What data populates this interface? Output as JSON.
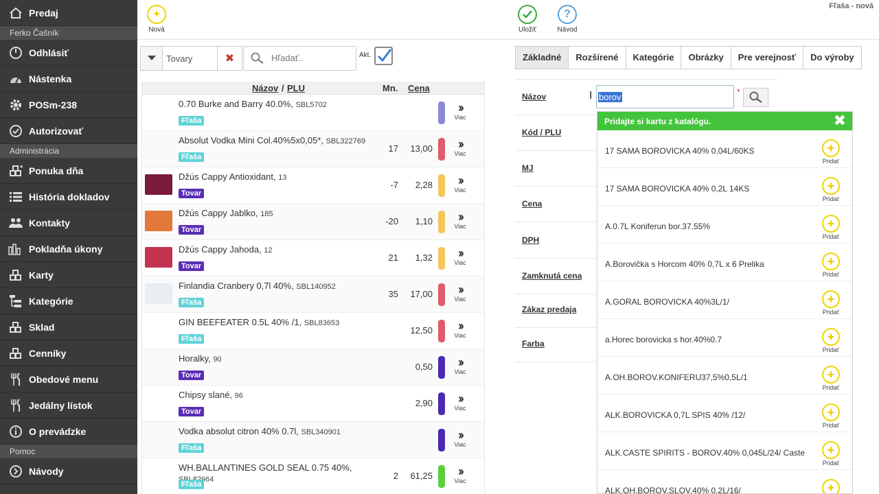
{
  "window_title": "Fľaša - nová",
  "sidebar": {
    "top_item": {
      "label": "Predaj",
      "icon": "home-icon"
    },
    "user_section": "Ferko Čašník",
    "user_items": [
      {
        "label": "Odhlásiť",
        "icon": "power-icon"
      },
      {
        "label": "Nástenka",
        "icon": "dashboard-icon"
      },
      {
        "label": "POSm-238",
        "icon": "gear-icon"
      },
      {
        "label": "Autorizovať",
        "icon": "check-circle-icon"
      }
    ],
    "admin_section": "Administrácia",
    "admin_items": [
      {
        "label": "Ponuka dňa",
        "icon": "blocks-star-icon"
      },
      {
        "label": "História dokladov",
        "icon": "list-icon"
      },
      {
        "label": "Kontakty",
        "icon": "users-icon"
      },
      {
        "label": "Pokladňa úkony",
        "icon": "bars-icon"
      },
      {
        "label": "Karty",
        "icon": "blocks-icon"
      },
      {
        "label": "Kategórie",
        "icon": "tree-icon"
      },
      {
        "label": "Sklad",
        "icon": "blocks-icon"
      },
      {
        "label": "Cenníky",
        "icon": "blocks-icon"
      },
      {
        "label": "Obedové menu",
        "icon": "cutlery-icon"
      },
      {
        "label": "Jedálny lístok",
        "icon": "cutlery-icon"
      },
      {
        "label": "O prevádzke",
        "icon": "info-icon"
      }
    ],
    "help_section": "Pomoc",
    "help_items": [
      {
        "label": "Návody",
        "icon": "arrow-circle-icon"
      }
    ]
  },
  "toolbar": {
    "new_label": "Nová",
    "save_label": "Uložiť",
    "help_label": "Návod"
  },
  "filter": {
    "category_value": "Tovary",
    "search_placeholder": "Hľadať..",
    "active_label": "Akt."
  },
  "table": {
    "headers": {
      "name": "Názov",
      "separator": " / ",
      "plu": "PLU",
      "qty": "Mn.",
      "price": "Cena"
    },
    "more_label": "Viac",
    "rows": [
      {
        "name": "0.70 Burke and Barry 40.0%,",
        "code": "SBL5702",
        "badge": "Fľaša",
        "badge_color": "#5fd3d8",
        "qty": "",
        "price": "",
        "bar_color": "#8a8ad6",
        "thumb": ""
      },
      {
        "name": "Absolut Vodka Mini Col.40%5x0,05*,",
        "code": "SBL322769",
        "badge": "Fľaša",
        "badge_color": "#5fd3d8",
        "qty": "17",
        "price": "13,00",
        "bar_color": "#e05c6a",
        "thumb": ""
      },
      {
        "name": "Džús Cappy Antioxidant,",
        "code": "13",
        "badge": "Tovar",
        "badge_color": "#5b2db5",
        "qty": "-7",
        "price": "2,28",
        "bar_color": "#f2c75c",
        "thumb": "#7a1b3a"
      },
      {
        "name": "Džús Cappy Jablko,",
        "code": "185",
        "badge": "Tovar",
        "badge_color": "#5b2db5",
        "qty": "-20",
        "price": "1,10",
        "bar_color": "#f2c75c",
        "thumb": "#e2783a"
      },
      {
        "name": "Džús Cappy Jahoda,",
        "code": "12",
        "badge": "Tovar",
        "badge_color": "#5b2db5",
        "qty": "21",
        "price": "1,32",
        "bar_color": "#f2c75c",
        "thumb": "#c23450"
      },
      {
        "name": "Finlandia Cranbery 0,7l 40%,",
        "code": "SBL140952",
        "badge": "Fľaša",
        "badge_color": "#5fd3d8",
        "qty": "35",
        "price": "17,00",
        "bar_color": "#e05c6a",
        "thumb": "#e8eef2"
      },
      {
        "name": "GIN BEEFEATER 0.5L 40% /1,",
        "code": "SBL83653",
        "badge": "Fľaša",
        "badge_color": "#5fd3d8",
        "qty": "",
        "price": "12,50",
        "bar_color": "#e05c6a",
        "thumb": ""
      },
      {
        "name": "Horalky,",
        "code": "90",
        "badge": "Tovar",
        "badge_color": "#5b2db5",
        "qty": "",
        "price": "0,50",
        "bar_color": "#4b2ab0",
        "thumb": ""
      },
      {
        "name": "Chipsy slané,",
        "code": "96",
        "badge": "Tovar",
        "badge_color": "#5b2db5",
        "qty": "",
        "price": "2,90",
        "bar_color": "#4b2ab0",
        "thumb": ""
      },
      {
        "name": "Vodka absolut citron 40% 0.7l,",
        "code": "SBL340901",
        "badge": "Fľaša",
        "badge_color": "#5fd3d8",
        "qty": "",
        "price": "",
        "bar_color": "#4b2ab0",
        "thumb": ""
      },
      {
        "name": "WH.BALLANTINES GOLD SEAL 0.75 40%,",
        "code": "SBL82964",
        "badge": "Fľaša",
        "badge_color": "#5fd3d8",
        "qty": "2",
        "price": "61,25",
        "bar_color": "#5ccf3c",
        "thumb": ""
      }
    ]
  },
  "tabs": [
    "Základné",
    "Rozšírené",
    "Kategórie",
    "Obrázky",
    "Pre verejnosť",
    "Do výroby"
  ],
  "form": {
    "labels": [
      "Názov",
      "Kód / PLU",
      "MJ",
      "Cena",
      "DPH",
      "Zamknutá cena",
      "Zákaz predaja",
      "Farba"
    ],
    "name_value": "borov",
    "required_mark": "*"
  },
  "catalog": {
    "header": "Pridajte si kartu z katalógu.",
    "add_label": "Pridať",
    "items": [
      "17 SAMA BOROVICKA 40% 0,04L/60KS",
      "17 SAMA BOROVICKA 40% 0,2L 14KS",
      "A.0.7L Koniferun bor.37.55%",
      "A.Borovička s Horcom 40% 0,7L x 6 Prelika",
      "A.GORAL BOROVICKA 40%3L/1/",
      "a.Horec borovicka s hor.40%0.7",
      "A.OH.BOROV.KONIFERU37,5%0,5L/1",
      "ALK.BOROVICKA 0,7L SPIS 40% /12/",
      "ALK.CASTE SPIRITS - BOROV.40% 0,045L/24/ Caste",
      "ALK.OH.BOROV.SLOV.40% 0,2L/16/"
    ]
  },
  "colors": {
    "sidebar_bg": "#3a3a3a",
    "accent_green": "#43c43c",
    "accent_yellow": "#f0d400",
    "accent_blue": "#5aa0d8"
  }
}
